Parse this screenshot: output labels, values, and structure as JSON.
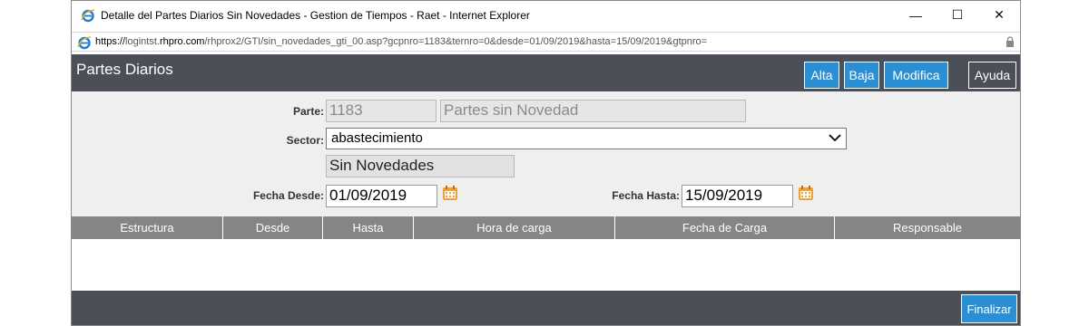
{
  "window": {
    "title": "Detalle del Partes Diarios Sin Novedades - Gestion de Tiempos - Raet - Internet Explorer",
    "controls": {
      "minimize": "—",
      "maximize": "☐",
      "close": "✕"
    }
  },
  "address_bar": {
    "scheme": "https://",
    "host_prefix": "logintst.",
    "host_domain": "rhpro.com",
    "path": "/rhprox2/GTI/sin_novedades_gti_00.asp?gcpnro=1183&ternro=0&desde=01/09/2019&hasta=15/09/2019&gtpnro="
  },
  "app": {
    "title": "Partes Diarios",
    "buttons": {
      "alta": "Alta",
      "baja": "Baja",
      "modifica": "Modifica",
      "ayuda": "Ayuda"
    }
  },
  "form": {
    "parte_label": "Parte:",
    "parte_number": "1183",
    "parte_description": "Partes sin Novedad",
    "sector_label": "Sector:",
    "sector_value": "abastecimiento",
    "type_value": "Sin Novedades",
    "fecha_desde_label": "Fecha Desde:",
    "fecha_desde_value": "01/09/2019",
    "fecha_hasta_label": "Fecha Hasta:",
    "fecha_hasta_value": "15/09/2019"
  },
  "table": {
    "headers": [
      "Estructura",
      "Desde",
      "Hasta",
      "Hora de carga",
      "Fecha de Carga",
      "Responsable"
    ],
    "rows": []
  },
  "footer": {
    "finalizar": "Finalizar"
  },
  "colors": {
    "accent": "#2a8fd4",
    "appbar": "#4b4f57",
    "form_bg": "#efefef",
    "table_header": "#858585",
    "calendar_icon": "#f0a030"
  }
}
